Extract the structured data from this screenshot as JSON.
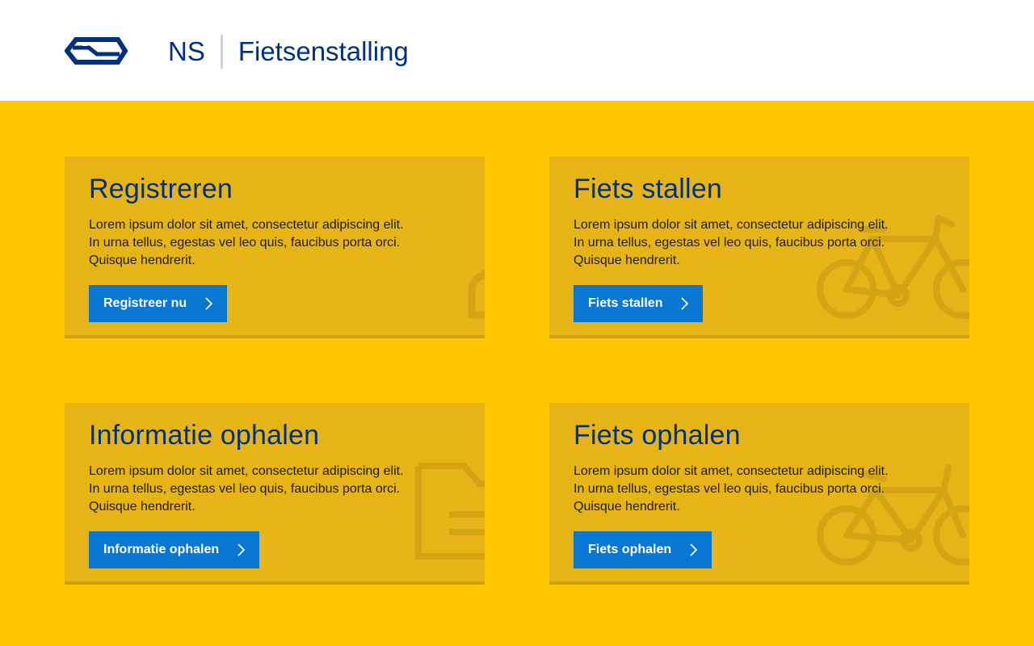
{
  "header": {
    "logo_icon": "ns-logo-icon",
    "brand": "NS",
    "product": "Fietsenstalling"
  },
  "colors": {
    "background": "#FFC700",
    "card": "#E6B417",
    "brand_blue": "#003082",
    "button_blue": "#0A78D2"
  },
  "cards": [
    {
      "title": "Registreren",
      "body": "Lorem ipsum dolor sit amet, consectetur adipiscing elit. In urna tellus, egestas vel leo quis, faucibus porta orci. Quisque hendrerit.",
      "button": "Registreer nu",
      "icon": "user-icon"
    },
    {
      "title": "Fiets stallen",
      "body": "Lorem ipsum dolor sit amet, consectetur adipiscing elit. In urna tellus, egestas vel leo quis, faucibus porta orci. Quisque hendrerit.",
      "button": "Fiets stallen",
      "icon": "bicycle-icon"
    },
    {
      "title": "Informatie ophalen",
      "body": "Lorem ipsum dolor sit amet, consectetur adipiscing elit. In urna tellus, egestas vel leo quis, faucibus porta orci. Quisque hendrerit.",
      "button": "Informatie ophalen",
      "icon": "document-icon"
    },
    {
      "title": "Fiets ophalen",
      "body": "Lorem ipsum dolor sit amet, consectetur adipiscing elit. In urna tellus, egestas vel leo quis, faucibus porta orci. Quisque hendrerit.",
      "button": "Fiets ophalen",
      "icon": "bicycle-icon"
    }
  ]
}
